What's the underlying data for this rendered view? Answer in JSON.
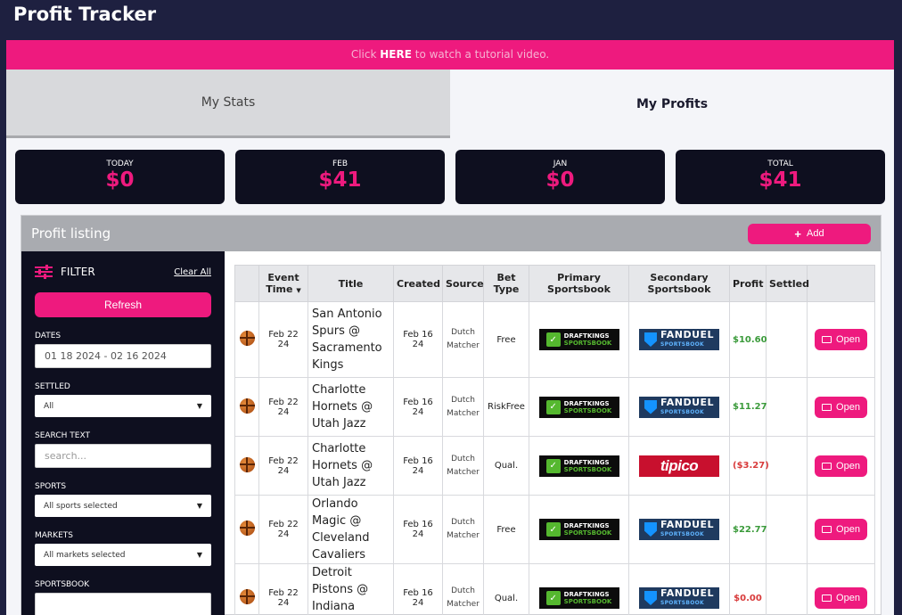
{
  "header": {
    "app_title": "Profit Tracker"
  },
  "banner": {
    "prefix": "Click ",
    "link": "HERE",
    "suffix": " to watch a tutorial video."
  },
  "tabs": [
    {
      "label": "My Stats"
    },
    {
      "label": "My Profits"
    }
  ],
  "cards": [
    {
      "label": "TODAY",
      "value": "$0"
    },
    {
      "label": "FEB",
      "value": "$41"
    },
    {
      "label": "JAN",
      "value": "$0"
    },
    {
      "label": "TOTAL",
      "value": "$41"
    }
  ],
  "listing": {
    "title": "Profit listing",
    "add_label": "Add"
  },
  "filter": {
    "title": "FILTER",
    "clear_label": "Clear All",
    "refresh_label": "Refresh",
    "dates_label": "DATES",
    "dates_value": "01 18 2024 - 02 16 2024",
    "settled_label": "SETTLED",
    "settled_value": "All",
    "search_label": "SEARCH TEXT",
    "search_placeholder": "search...",
    "sports_label": "SPORTS",
    "sports_value": "All sports selected",
    "markets_label": "MARKETS",
    "markets_value": "All markets selected",
    "sportsbook_label": "SPORTSBOOK"
  },
  "table": {
    "headers": {
      "event_time": "Event Time",
      "sort_indicator": "▼",
      "title": "Title",
      "created": "Created",
      "source": "Source",
      "bet_type": "Bet Type",
      "primary": "Primary Sportsbook",
      "secondary": "Secondary Sportsbook",
      "profit": "Profit",
      "settled": "Settled"
    },
    "open_label": "Open",
    "logo_text": {
      "dk_top": "DRAFTKINGS",
      "dk_bottom": "SPORTSBOOK",
      "fd_top": "FANDUEL",
      "fd_bottom": "SPORTSBOOK",
      "tipico": "tipico"
    },
    "rows": [
      {
        "event_time": "Feb 22 24",
        "title": "San Antonio Spurs @ Sacramento Kings",
        "created": "Feb 16 24",
        "source_1": "Dutch",
        "source_2": "Matcher",
        "bet_type": "Free",
        "primary": "draftkings",
        "secondary": "fanduel",
        "profit": "$10.60",
        "profit_state": "pos",
        "settled": ""
      },
      {
        "event_time": "Feb 22 24",
        "title": "Charlotte Hornets @ Utah Jazz",
        "created": "Feb 16 24",
        "source_1": "Dutch",
        "source_2": "Matcher",
        "bet_type": "RiskFree",
        "primary": "draftkings",
        "secondary": "fanduel",
        "profit": "$11.27",
        "profit_state": "pos",
        "settled": ""
      },
      {
        "event_time": "Feb 22 24",
        "title": "Charlotte Hornets @ Utah Jazz",
        "created": "Feb 16 24",
        "source_1": "Dutch",
        "source_2": "Matcher",
        "bet_type": "Qual.",
        "primary": "draftkings",
        "secondary": "tipico",
        "profit": "($3.27)",
        "profit_state": "neg",
        "settled": ""
      },
      {
        "event_time": "Feb 22 24",
        "title": "Orlando Magic @ Cleveland Cavaliers",
        "created": "Feb 16 24",
        "source_1": "Dutch",
        "source_2": "Matcher",
        "bet_type": "Free",
        "primary": "draftkings",
        "secondary": "fanduel",
        "profit": "$22.77",
        "profit_state": "pos",
        "settled": ""
      },
      {
        "event_time": "Feb 22 24",
        "title": "Detroit Pistons @ Indiana Pacers",
        "created": "Feb 16 24",
        "source_1": "Dutch",
        "source_2": "Matcher",
        "bet_type": "Qual.",
        "primary": "draftkings",
        "secondary": "fanduel",
        "profit": "$0.00",
        "profit_state": "neg",
        "settled": ""
      }
    ]
  },
  "colors": {
    "accent": "#ee1a7e",
    "navy": "#1e2040",
    "card_bg": "#0e0f1f",
    "profit_pos": "#3a9a3a",
    "profit_neg": "#d83a3a"
  }
}
